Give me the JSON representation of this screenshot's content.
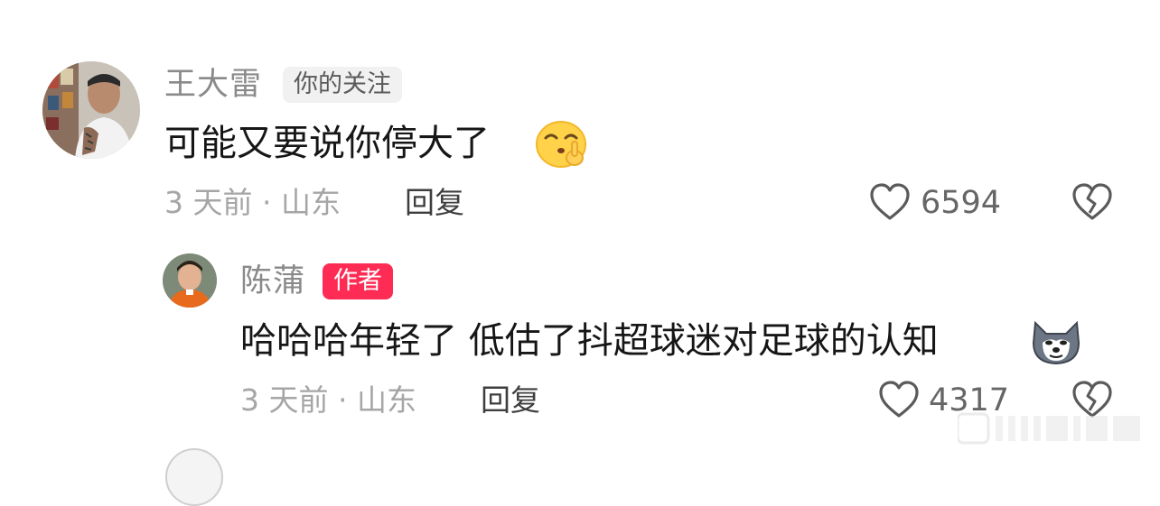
{
  "comments": [
    {
      "username": "王大雷",
      "badge": "你的关注",
      "text": "可能又要说你停大了",
      "emoji": "shushing-face-emoji",
      "time_location": "3 天前 · 山东",
      "reply_label": "回复",
      "likes": "6594"
    },
    {
      "username": "陈蒲",
      "badge": "作者",
      "text": "哈哈哈年轻了 低估了抖超球迷对足球的认知",
      "emoji": "doge-emoji",
      "time_location": "3 天前 · 山东",
      "reply_label": "回复",
      "likes": "4317"
    }
  ],
  "colors": {
    "author_badge": "#fe2c55",
    "follow_badge_bg": "#f1f1f1",
    "meta_text": "#a6a6a6",
    "name_text": "#8a8a8a"
  }
}
